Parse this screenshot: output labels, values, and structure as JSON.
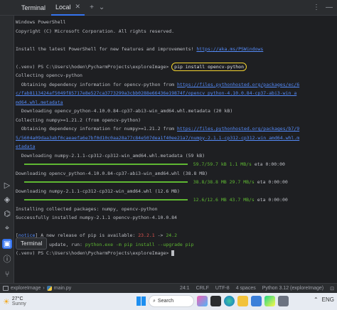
{
  "tabbar": {
    "title": "Terminal",
    "active_tab": "Local",
    "close_glyph": "✕",
    "add_glyph": "+",
    "dropdown_glyph": "⌄",
    "menu_glyph": "⋮",
    "minimize_glyph": "—"
  },
  "terminal": {
    "line1": "Windows PowerShell",
    "line2": "Copyright (C) Microsoft Corporation. All rights reserved.",
    "line4_text": "Install the latest PowerShell for new features and improvements! ",
    "line4_link": "https://aka.ms/PSWindows",
    "prompt1": "(.venv) PS C:\\Users\\hoden\\PycharmProjects\\exploreImage> ",
    "command": "pip install opencv-python",
    "collecting_opencv": "Collecting opencv-python",
    "obtaining_opencv": "  Obtaining dependency information for opencv-python from ",
    "opencv_url1": "https://files.pythonhosted.org/packages/ec/6",
    "opencv_url2": "c/fab8113424af5049f85717e8e527ca3773299a3cbb0288e66436e19874f/opencv_python-4.10.0.84-cp37-abi3-win_a",
    "opencv_url3": "md64.whl.metadata",
    "dl_opencv_meta": "  Downloading opencv_python-4.10.0.84-cp37-abi3-win_amd64.whl.metadata (20 kB)",
    "collecting_numpy": "Collecting numpy>=1.21.2 (from opencv-python)",
    "obtaining_numpy": "  Obtaining dependency information for numpy>=1.21.2 from ",
    "numpy_url1": "https://files.pythonhosted.org/packages/b7/9",
    "numpy_url2": "5/5604a09daa3abf0caeaefa6e7bf0d10c0aa28a77c84e507dea1f40ee21a7/numpy-2.1.1-cp312-cp312-win_amd64.whl.m",
    "numpy_url3": "etadata",
    "dl_numpy_meta": "  Downloading numpy-2.1.1-cp312-cp312-win_amd64.whl.metadata (59 kB)",
    "progress1": "59.7/59.7 kB 1.1 MB/s",
    "eta1": " eta 0:00:00",
    "dl_opencv_whl": "Downloading opencv_python-4.10.0.84-cp37-abi3-win_amd64.whl (38.8 MB)",
    "progress2": "38.8/38.8 MB 29.7 MB/s",
    "eta2": " eta 0:00:00",
    "dl_numpy_whl": "Downloading numpy-2.1.1-cp312-cp312-win_amd64.whl (12.6 MB)",
    "progress3": "12.6/12.6 MB 43.7 MB/s",
    "eta3": " eta 0:00:00",
    "installing": "Installing collected packages: numpy, opencv-python",
    "success": "Successfully installed numpy-2.1.1 opencv-python-4.10.0.84",
    "notice_tag": "notice",
    "notice1_text": " A new release of pip is available: ",
    "notice1_old": "23.2.1",
    "notice1_arrow": " -> ",
    "notice1_new": "24.2",
    "notice2_text": " To update, run: ",
    "notice2_cmd": "python.exe -m pip install --upgrade pip",
    "prompt2": "(.venv) PS C:\\Users\\hoden\\PycharmProjects\\exploreImage> "
  },
  "tooltip": "Terminal",
  "statusbar": {
    "project": "exploreImage",
    "separator": "›",
    "file": "main.py",
    "position": "24:1",
    "line_ending": "CRLF",
    "encoding": "UTF-8",
    "indent": "4 spaces",
    "interpreter": "Python 3.12 (exploreImage)"
  },
  "taskbar": {
    "weather_temp": "27°C",
    "weather_desc": "Sunny",
    "search_label": "Search",
    "tray_lang": "ENG"
  },
  "colors": {
    "accent": "#3574f0",
    "link": "#548af7",
    "progress": "#5fb832",
    "highlight_border": "#f2d230"
  }
}
